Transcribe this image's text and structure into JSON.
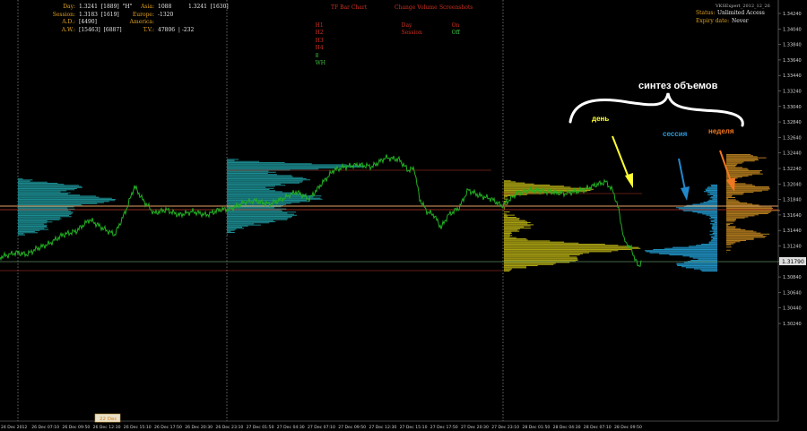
{
  "colors": {
    "background": "#000000",
    "price_line": "#22b022",
    "grid_vline": "#b0b0b0",
    "level_red": "#c0392b",
    "level_orange": "#e8a060",
    "level_green": "#88cc88",
    "profile_teal": "#1b8a8f",
    "profile_olive": "#a8a012",
    "profile_blue": "#1f8fc0",
    "profile_brown": "#b07a1e",
    "menu_red": "#d03020",
    "menu_green": "#40c040",
    "axis_text": "#cfcfcf"
  },
  "info_panel": {
    "day_label": "Day:",
    "day_value": "1.3241  [1889]  \"H\"",
    "session_label": "Session:",
    "session_value": "1.3183  [1619]",
    "ad_label": "A.D.:",
    "ad_value": "[4490]",
    "aw_label": "A.W.:",
    "aw_value": "[15463]  [6887]",
    "asia_label": "Asia:",
    "asia_value": "1088",
    "asia_extra": "1.3241  [1630]",
    "europe_label": "Europe:",
    "europe_value": "-1320",
    "america_label": "America:",
    "america_value": "",
    "tv_label": "T.V.:",
    "tv_value": "47806  | -232"
  },
  "menu": {
    "tf_title": "TF Bar Chart",
    "tf_buttons": [
      "H1",
      "H2",
      "H3",
      "H4",
      "8",
      "WH"
    ],
    "cv_title": "Change Volume",
    "cv_buttons": [
      "Day",
      "Session"
    ],
    "ss_title": "Screenshots",
    "ss_buttons": [
      "On",
      "Off"
    ]
  },
  "status_panel": {
    "title": "VKSExpert_2012_12_26",
    "status_label": "Status:",
    "status_value": "Unlimited Access",
    "expiry_label": "Expiry date:",
    "expiry_value": "Never"
  },
  "annotations": {
    "synthesis": "синтез объемов",
    "day": "день",
    "session": "сессия",
    "week": "неделя"
  },
  "price_axis": {
    "labels": [
      "1.34240",
      "1.34040",
      "1.33840",
      "1.33640",
      "1.33440",
      "1.33240",
      "1.33040",
      "1.32840",
      "1.32640",
      "1.32440",
      "1.32240",
      "1.32040",
      "1.31840",
      "1.31640",
      "1.31440",
      "1.31240",
      "1.31040",
      "1.30840",
      "1.30640",
      "1.30440",
      "1.30240"
    ],
    "current_price": "1.31790"
  },
  "time_axis": {
    "labels": [
      "24 Dec 2012",
      "26 Dec 07:10",
      "26 Dec 09:50",
      "26 Dec 12:30",
      "26 Dec 15:10",
      "26 Dec 17:50",
      "26 Dec 20:30",
      "26 Dec 23:10",
      "27 Dec 01:50",
      "27 Dec 04:30",
      "27 Dec 07:10",
      "27 Dec 09:50",
      "27 Dec 12:30",
      "27 Dec 15:10",
      "27 Dec 17:50",
      "27 Dec 20:30",
      "27 Dec 23:10",
      "28 Dec 01:50",
      "28 Dec 04:30",
      "28 Dec 07:10",
      "28 Dec 09:50"
    ],
    "scroll_marker": "22 Dec"
  }
}
